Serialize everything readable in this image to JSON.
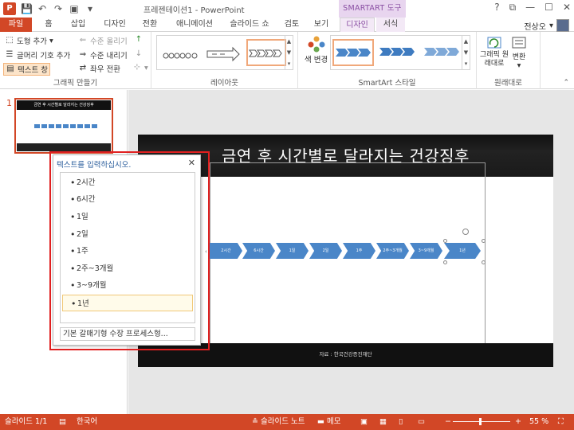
{
  "app": {
    "title": "프레젠테이션1 - PowerPoint",
    "contextual_header": "SMARTART 도구",
    "window_controls": [
      "?",
      "⧉",
      "—",
      "☐",
      "✕"
    ]
  },
  "tabs": [
    {
      "label": "파일"
    },
    {
      "label": "홈"
    },
    {
      "label": "삽입"
    },
    {
      "label": "디자인"
    },
    {
      "label": "전환"
    },
    {
      "label": "애니메이션"
    },
    {
      "label": "슬라이드 쇼"
    },
    {
      "label": "검토"
    },
    {
      "label": "보기"
    },
    {
      "label": "디자인"
    },
    {
      "label": "서식"
    }
  ],
  "user": {
    "name": "전상오"
  },
  "ribbon": {
    "create_graphic": {
      "label": "그래픽 만들기",
      "add_shape": "도형 추가",
      "add_bullet": "글머리 기호 추가",
      "text_pane": "텍스트 창",
      "promote": "수준 올리기",
      "demote": "수준 내리기",
      "right_to_left": "좌우 전환"
    },
    "layouts": {
      "label": "레이아웃"
    },
    "styles": {
      "label": "SmartArt 스타일",
      "change_colors": "색 변경"
    },
    "reset": {
      "label": "원래대로",
      "reset_graphic": "그래픽 원래대로",
      "convert": "변환"
    }
  },
  "slides_pane": {
    "slide_number": "1"
  },
  "slide": {
    "title": "금연 후 시간별로 달라지는 건강징후",
    "source": "자료 : 한국건강증진재단",
    "steps": [
      "2시간",
      "6시간",
      "1일",
      "2일",
      "1주",
      "2주~3개월",
      "3~9개월",
      "1년"
    ]
  },
  "text_pane": {
    "title": "텍스트를 입력하십시오.",
    "items": [
      "2시간",
      "6시간",
      "1일",
      "2일",
      "1주",
      "2주~3개월",
      "3~9개월",
      "1년"
    ],
    "footer": "기본 갈매기형 수장 프로세스형..."
  },
  "status": {
    "slide_counter": "슬라이드 1/1",
    "language": "한국어",
    "notes": "슬라이드 노트",
    "comments": "메모",
    "zoom": "55 %"
  },
  "colors": {
    "accent": "#d24726",
    "smartart_blue": "#4a86c8",
    "contextual": "#8a4fa3"
  }
}
